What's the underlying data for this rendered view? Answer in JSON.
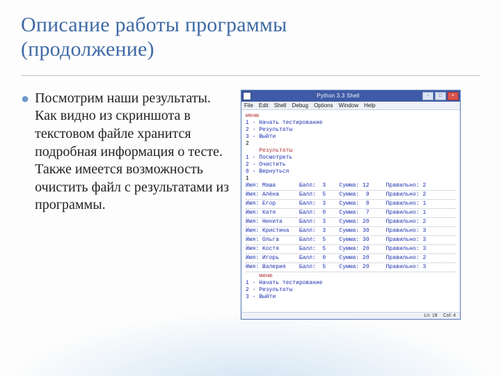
{
  "title_l1": "Описание работы программы",
  "title_l2": "(продолжение)",
  "bullet_text": "Посмотрим наши результаты. Как видно из скриншота в текстовом файле хранится подробная информация о тесте. Также имеется возможность очистить файл с результатами из программы.",
  "window": {
    "title": "Python 3.3 Shell",
    "btn_min": "-",
    "btn_max": "□",
    "btn_close": "×",
    "menu": [
      "File",
      "Edit",
      "Shell",
      "Debug",
      "Options",
      "Window",
      "Help"
    ],
    "status_ln": "Ln: 18",
    "status_col": "Col: 4"
  },
  "console": {
    "menu_block": [
      "меню",
      "1 - Начать тестирование",
      "2 - Результаты",
      "3 - Выйти",
      "",
      "2"
    ],
    "sub_block": [
      "    Результаты",
      "1 - Посмотреть",
      "2 - Очистить",
      "0 - Вернуться",
      "",
      "1"
    ],
    "rows": [
      {
        "name": "Имя: Маша",
        "ball": "Балл:  3",
        "sum": "Сумма: 12",
        "prav": "Правильно: 2"
      },
      {
        "name": "Имя: Алёна",
        "ball": "Балл:  5",
        "sum": "Сумма:  9",
        "prav": "Правильно: 2"
      },
      {
        "name": "Имя: Егор",
        "ball": "Балл:  3",
        "sum": "Сумма:  8",
        "prav": "Правильно: 1"
      },
      {
        "name": "Имя: Катя",
        "ball": "Балл:  0",
        "sum": "Сумма:  7",
        "prav": "Правильно: 1"
      },
      {
        "name": "Имя: Никита",
        "ball": "Балл:  3",
        "sum": "Сумма: 20",
        "prav": "Правильно: 2"
      },
      {
        "name": "Имя: Кристина",
        "ball": "Балл:  3",
        "sum": "Сумма: 30",
        "prav": "Правильно: 3"
      },
      {
        "name": "Имя: Ольга",
        "ball": "Балл:  5",
        "sum": "Сумма: 30",
        "prav": "Правильно: 3"
      },
      {
        "name": "Имя: Костя",
        "ball": "Балл:  5",
        "sum": "Сумма: 20",
        "prav": "Правильно: 3"
      },
      {
        "name": "Имя: Игорь",
        "ball": "Балл:  0",
        "sum": "Сумма: 20",
        "prav": "Правильно: 2"
      },
      {
        "name": "Имя: Валерия",
        "ball": "Балл:  5",
        "sum": "Сумма: 20",
        "prav": "Правильно: 3"
      }
    ],
    "tail": [
      "    меню",
      "1 - Начать тестирование",
      "2 - Результаты",
      "3 - Выйти"
    ]
  }
}
